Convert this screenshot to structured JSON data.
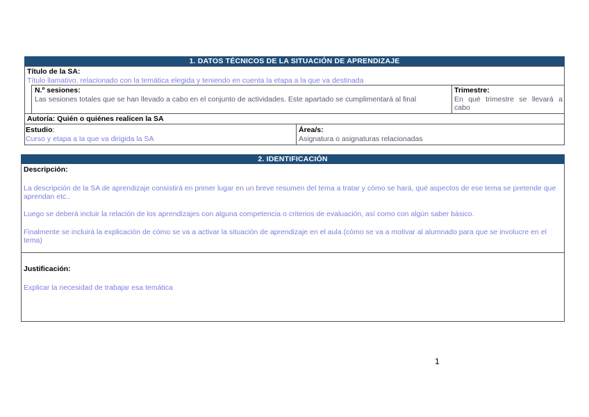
{
  "section1": {
    "header": "1.   DATOS TÉCNICOS DE LA SITUACIÓN DE APRENDIZAJE",
    "titulo_label": "Título de la SA:",
    "titulo_value": "Título llamativo, relacionado con la temática elegida y teniendo en cuenta la etapa a la que va destinada",
    "sesiones_label": "N.º sesiones:",
    "sesiones_value": "Las sesiones totales que se han llevado a cabo en el conjunto de actividades. Este apartado se cumplimentará al final",
    "trimestre_label": "Trimestre:",
    "trimestre_value": "En qué trimestre se llevará a cabo",
    "autoria_label": "Autoría: Quién o quiénes realicen la SA",
    "estudio_label": "Estudio",
    "estudio_colon": ":",
    "estudio_value": "Curso y etapa a la que va dirigida la SA",
    "area_label": "Área/s:",
    "area_value": "Asignatura o asignaturas relacionadas"
  },
  "section2": {
    "header": "2.   IDENTIFICACIÓN",
    "descripcion_label": "Descripción:",
    "descripcion_p1": "La descripción de la SA de aprendizaje consistirá en primer lugar en un breve resumen del tema a tratar y cómo se hará, qué aspectos de ese tema se pretende que aprendan etc..",
    "descripcion_p2": "Luego se deberá incluir la relación de los aprendizajes con alguna competencia o criterios de evaluación, así como con algún saber básico.",
    "descripcion_p3": " Finalmente se incluirá la explicación de cómo se va a activar la situación de aprendizaje en el aula (cómo se va a motivar al alumnado para que se involucre en el tema)",
    "justificacion_label": "Justificación:",
    "justificacion_value": "Explicar la necesidad de trabajar esa temática"
  },
  "page_number": "1"
}
